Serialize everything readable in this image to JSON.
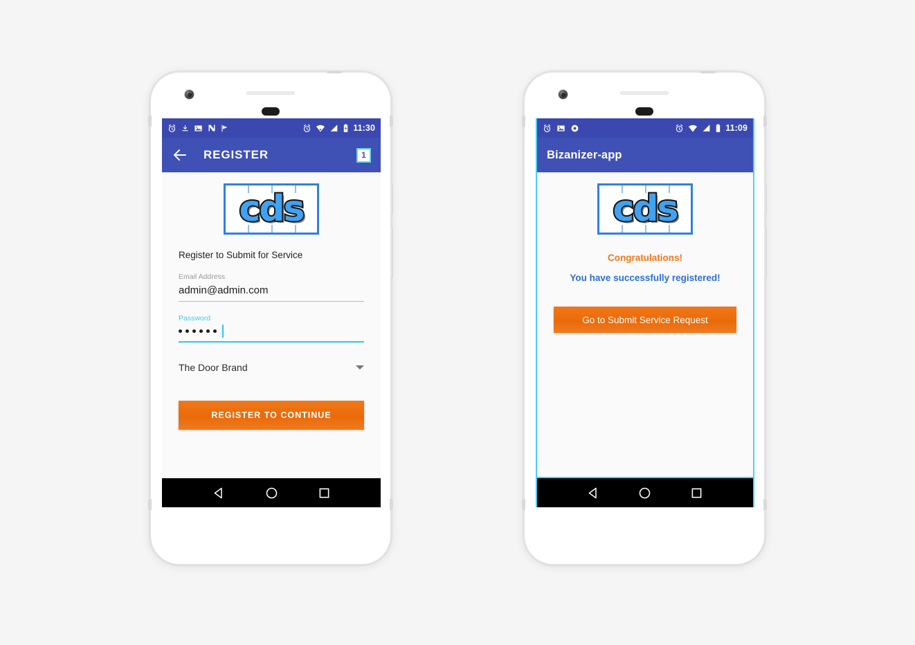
{
  "phones": [
    {
      "id": "register-phone",
      "status_bar": {
        "left_icons": [
          "alarm-icon",
          "download-icon",
          "image-icon",
          "n-app-icon",
          "play-flag-icon"
        ],
        "right_icons": [
          "alarm-icon",
          "wifi-icon",
          "signal-icon",
          "battery-charging-icon"
        ],
        "time": "11:30"
      },
      "app_bar": {
        "back_icon": "back-arrow-icon",
        "title": "REGISTER",
        "badge": "1"
      },
      "logo": {
        "text": "cds",
        "border_color": "#2f7fe0",
        "letter_color": "#3fa2f2"
      },
      "form": {
        "heading": "Register to Submit for Service",
        "email": {
          "label": "Email Address",
          "value": "admin@admin.com",
          "placeholder": "Email Address"
        },
        "password": {
          "label": "Password",
          "value": "••••••",
          "dots": 6,
          "placeholder": "Password"
        },
        "brand_select": {
          "value": "The Door Brand",
          "chevron": "chevron-down-icon"
        },
        "submit_label": "REGISTER TO CONTINUE"
      },
      "nav_bar": [
        "back-triangle-icon",
        "home-circle-icon",
        "recents-square-icon"
      ]
    },
    {
      "id": "success-phone",
      "status_bar": {
        "left_icons": [
          "alarm-icon",
          "image-icon",
          "record-circle-icon"
        ],
        "right_icons": [
          "alarm-icon",
          "wifi-icon",
          "signal-icon",
          "battery-icon"
        ],
        "time": "11:09"
      },
      "app_bar": {
        "title": "Bizanizer-app"
      },
      "logo": {
        "text": "cds",
        "border_color": "#2f7fe0",
        "letter_color": "#3fa2f2"
      },
      "success": {
        "congrats": "Congratulations!",
        "message": "You have successfully registered!",
        "cta_label": "Go to Submit Service Request"
      },
      "nav_bar": [
        "back-triangle-icon",
        "home-circle-icon",
        "recents-square-icon"
      ]
    }
  ],
  "colors": {
    "status_bar": "#3a48b0",
    "app_bar": "#3f51b5",
    "accent_orange": "#ea6a09",
    "accent_cyan": "#2fc3f2",
    "screen_border_cyan": "#45d0f5",
    "link_blue": "#2a6fd6",
    "page_background": "#f5f5f5"
  }
}
